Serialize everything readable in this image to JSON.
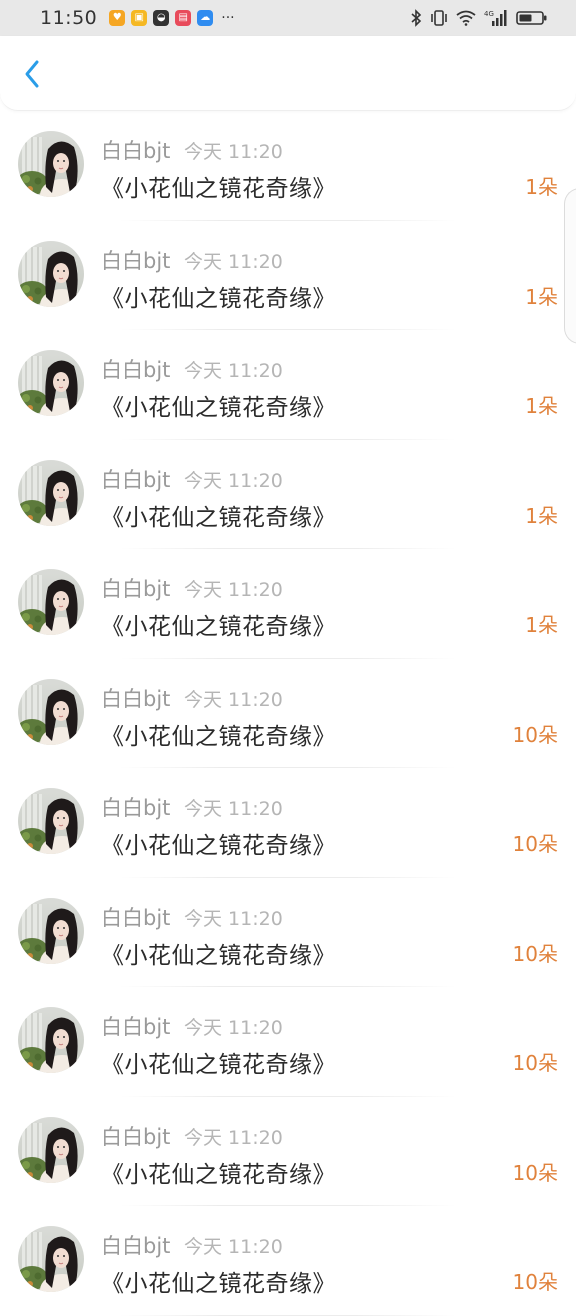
{
  "status_bar": {
    "time": "11:50",
    "more": "···",
    "network_label": "4G",
    "app_icons": [
      {
        "name": "heart-app-icon",
        "color": "#f5a623"
      },
      {
        "name": "cup-app-icon",
        "color": "#f5b823"
      },
      {
        "name": "chat-app-icon",
        "color": "#333333"
      },
      {
        "name": "book-app-icon",
        "color": "#e84b5b"
      },
      {
        "name": "cloud-app-icon",
        "color": "#2f8cf0"
      }
    ]
  },
  "nav": {
    "back_icon": "chevron-left-icon",
    "accent_color": "#2a9de8"
  },
  "records": [
    {
      "user": "白白bjt",
      "time": "今天 11:20",
      "gift": "《小花仙之镜花奇缘》",
      "count": "1朵"
    },
    {
      "user": "白白bjt",
      "time": "今天 11:20",
      "gift": "《小花仙之镜花奇缘》",
      "count": "1朵"
    },
    {
      "user": "白白bjt",
      "time": "今天 11:20",
      "gift": "《小花仙之镜花奇缘》",
      "count": "1朵"
    },
    {
      "user": "白白bjt",
      "time": "今天 11:20",
      "gift": "《小花仙之镜花奇缘》",
      "count": "1朵"
    },
    {
      "user": "白白bjt",
      "time": "今天 11:20",
      "gift": "《小花仙之镜花奇缘》",
      "count": "1朵"
    },
    {
      "user": "白白bjt",
      "time": "今天 11:20",
      "gift": "《小花仙之镜花奇缘》",
      "count": "10朵"
    },
    {
      "user": "白白bjt",
      "time": "今天 11:20",
      "gift": "《小花仙之镜花奇缘》",
      "count": "10朵"
    },
    {
      "user": "白白bjt",
      "time": "今天 11:20",
      "gift": "《小花仙之镜花奇缘》",
      "count": "10朵"
    },
    {
      "user": "白白bjt",
      "time": "今天 11:20",
      "gift": "《小花仙之镜花奇缘》",
      "count": "10朵"
    },
    {
      "user": "白白bjt",
      "time": "今天 11:20",
      "gift": "《小花仙之镜花奇缘》",
      "count": "10朵"
    },
    {
      "user": "白白bjt",
      "time": "今天 11:20",
      "gift": "《小花仙之镜花奇缘》",
      "count": "10朵"
    }
  ],
  "colors": {
    "count": "#e0823c",
    "name": "#9a9a9a",
    "time": "#b5b5b5",
    "title": "#2b2b2b"
  }
}
